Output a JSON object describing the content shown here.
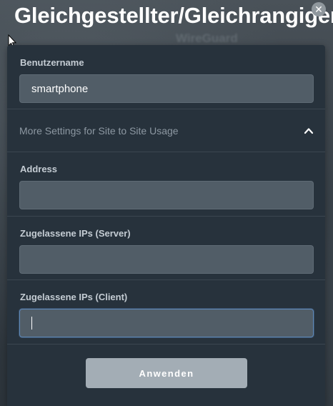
{
  "dialog": {
    "title": "Gleichgestellter/Gleichrangiger",
    "background_text": "WireGuard",
    "close_icon": "close-icon"
  },
  "form": {
    "username": {
      "label": "Benutzername",
      "value": "smartphone"
    },
    "more_settings": {
      "label": "More Settings for Site to Site Usage",
      "expanded": true,
      "icon": "chevron-up-icon"
    },
    "address": {
      "label": "Address",
      "value": ""
    },
    "allowed_ips_server": {
      "label": "Zugelassene IPs (Server)",
      "value": ""
    },
    "allowed_ips_client": {
      "label": "Zugelassene IPs (Client)",
      "value": "",
      "focused": true
    },
    "apply_label": "Anwenden"
  },
  "colors": {
    "panel": "#27323c",
    "input": "#515d67",
    "focus_border": "#5e88b7",
    "button": "#a3adb5"
  }
}
